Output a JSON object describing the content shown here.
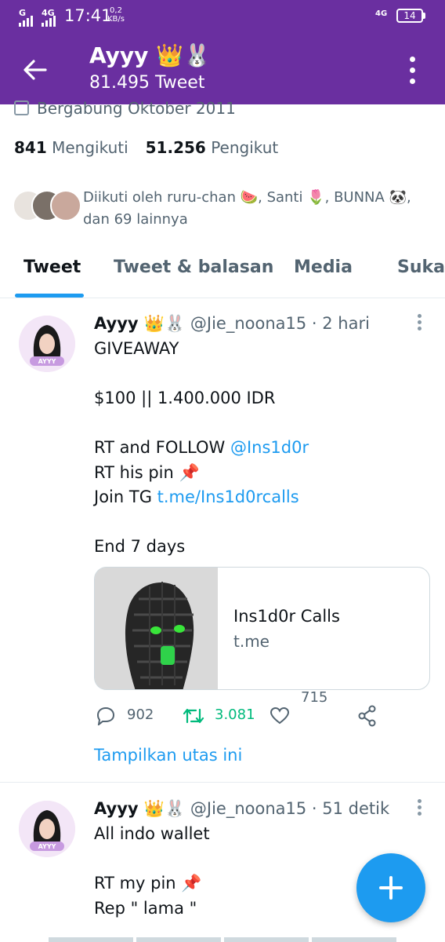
{
  "status_bar": {
    "sim1": "G",
    "sim2": "4G",
    "time": "17:41",
    "speed_value": "0,2",
    "speed_unit": "KB/s",
    "network": "4G",
    "battery": "14"
  },
  "header": {
    "name": "Ayyy 👑🐰",
    "tweet_count": "81.495 Tweet"
  },
  "profile": {
    "joined": "Bergabung Oktober 2011",
    "following_count": "841",
    "following_label": "Mengikuti",
    "followers_count": "51.256",
    "followers_label": "Pengikut",
    "followed_by": "Diikuti oleh ruru-chan 🍉, Santi 🌷, BUNNA 🐼, dan 69 lainnya"
  },
  "tabs": [
    {
      "label": "Tweet",
      "active": true
    },
    {
      "label": "Tweet & balasan",
      "active": false
    },
    {
      "label": "Media",
      "active": false
    },
    {
      "label": "Suka",
      "active": false
    }
  ],
  "tweets": [
    {
      "name": "Ayyy 👑🐰",
      "handle_time": "@Jie_noona15 · 2 hari",
      "lines": {
        "l1": "GIVEAWAY",
        "l2": "$100 || 1.400.000 IDR",
        "l3_text": "RT and FOLLOW ",
        "l3_link": "@Ins1d0r",
        "l4": "RT his pin 📌",
        "l5_text": "Join TG ",
        "l5_link": "t.me/Ins1d0rcalls",
        "l6": "End 7 days"
      },
      "card": {
        "title": "Ins1d0r Calls",
        "domain": "t.me"
      },
      "replies": "902",
      "retweets": "3.081",
      "likes": "715",
      "show_thread": "Tampilkan utas ini"
    },
    {
      "name": "Ayyy 👑🐰",
      "handle_time": "@Jie_noona15 · 51 detik",
      "lines": {
        "l1": "All indo wallet",
        "l2": "RT my pin 📌",
        "l3": "Rep \" lama \""
      }
    }
  ],
  "colors": {
    "header_bg": "#6a2fa0",
    "accent": "#1d9bf0",
    "retweet_green": "#00ba7c"
  }
}
